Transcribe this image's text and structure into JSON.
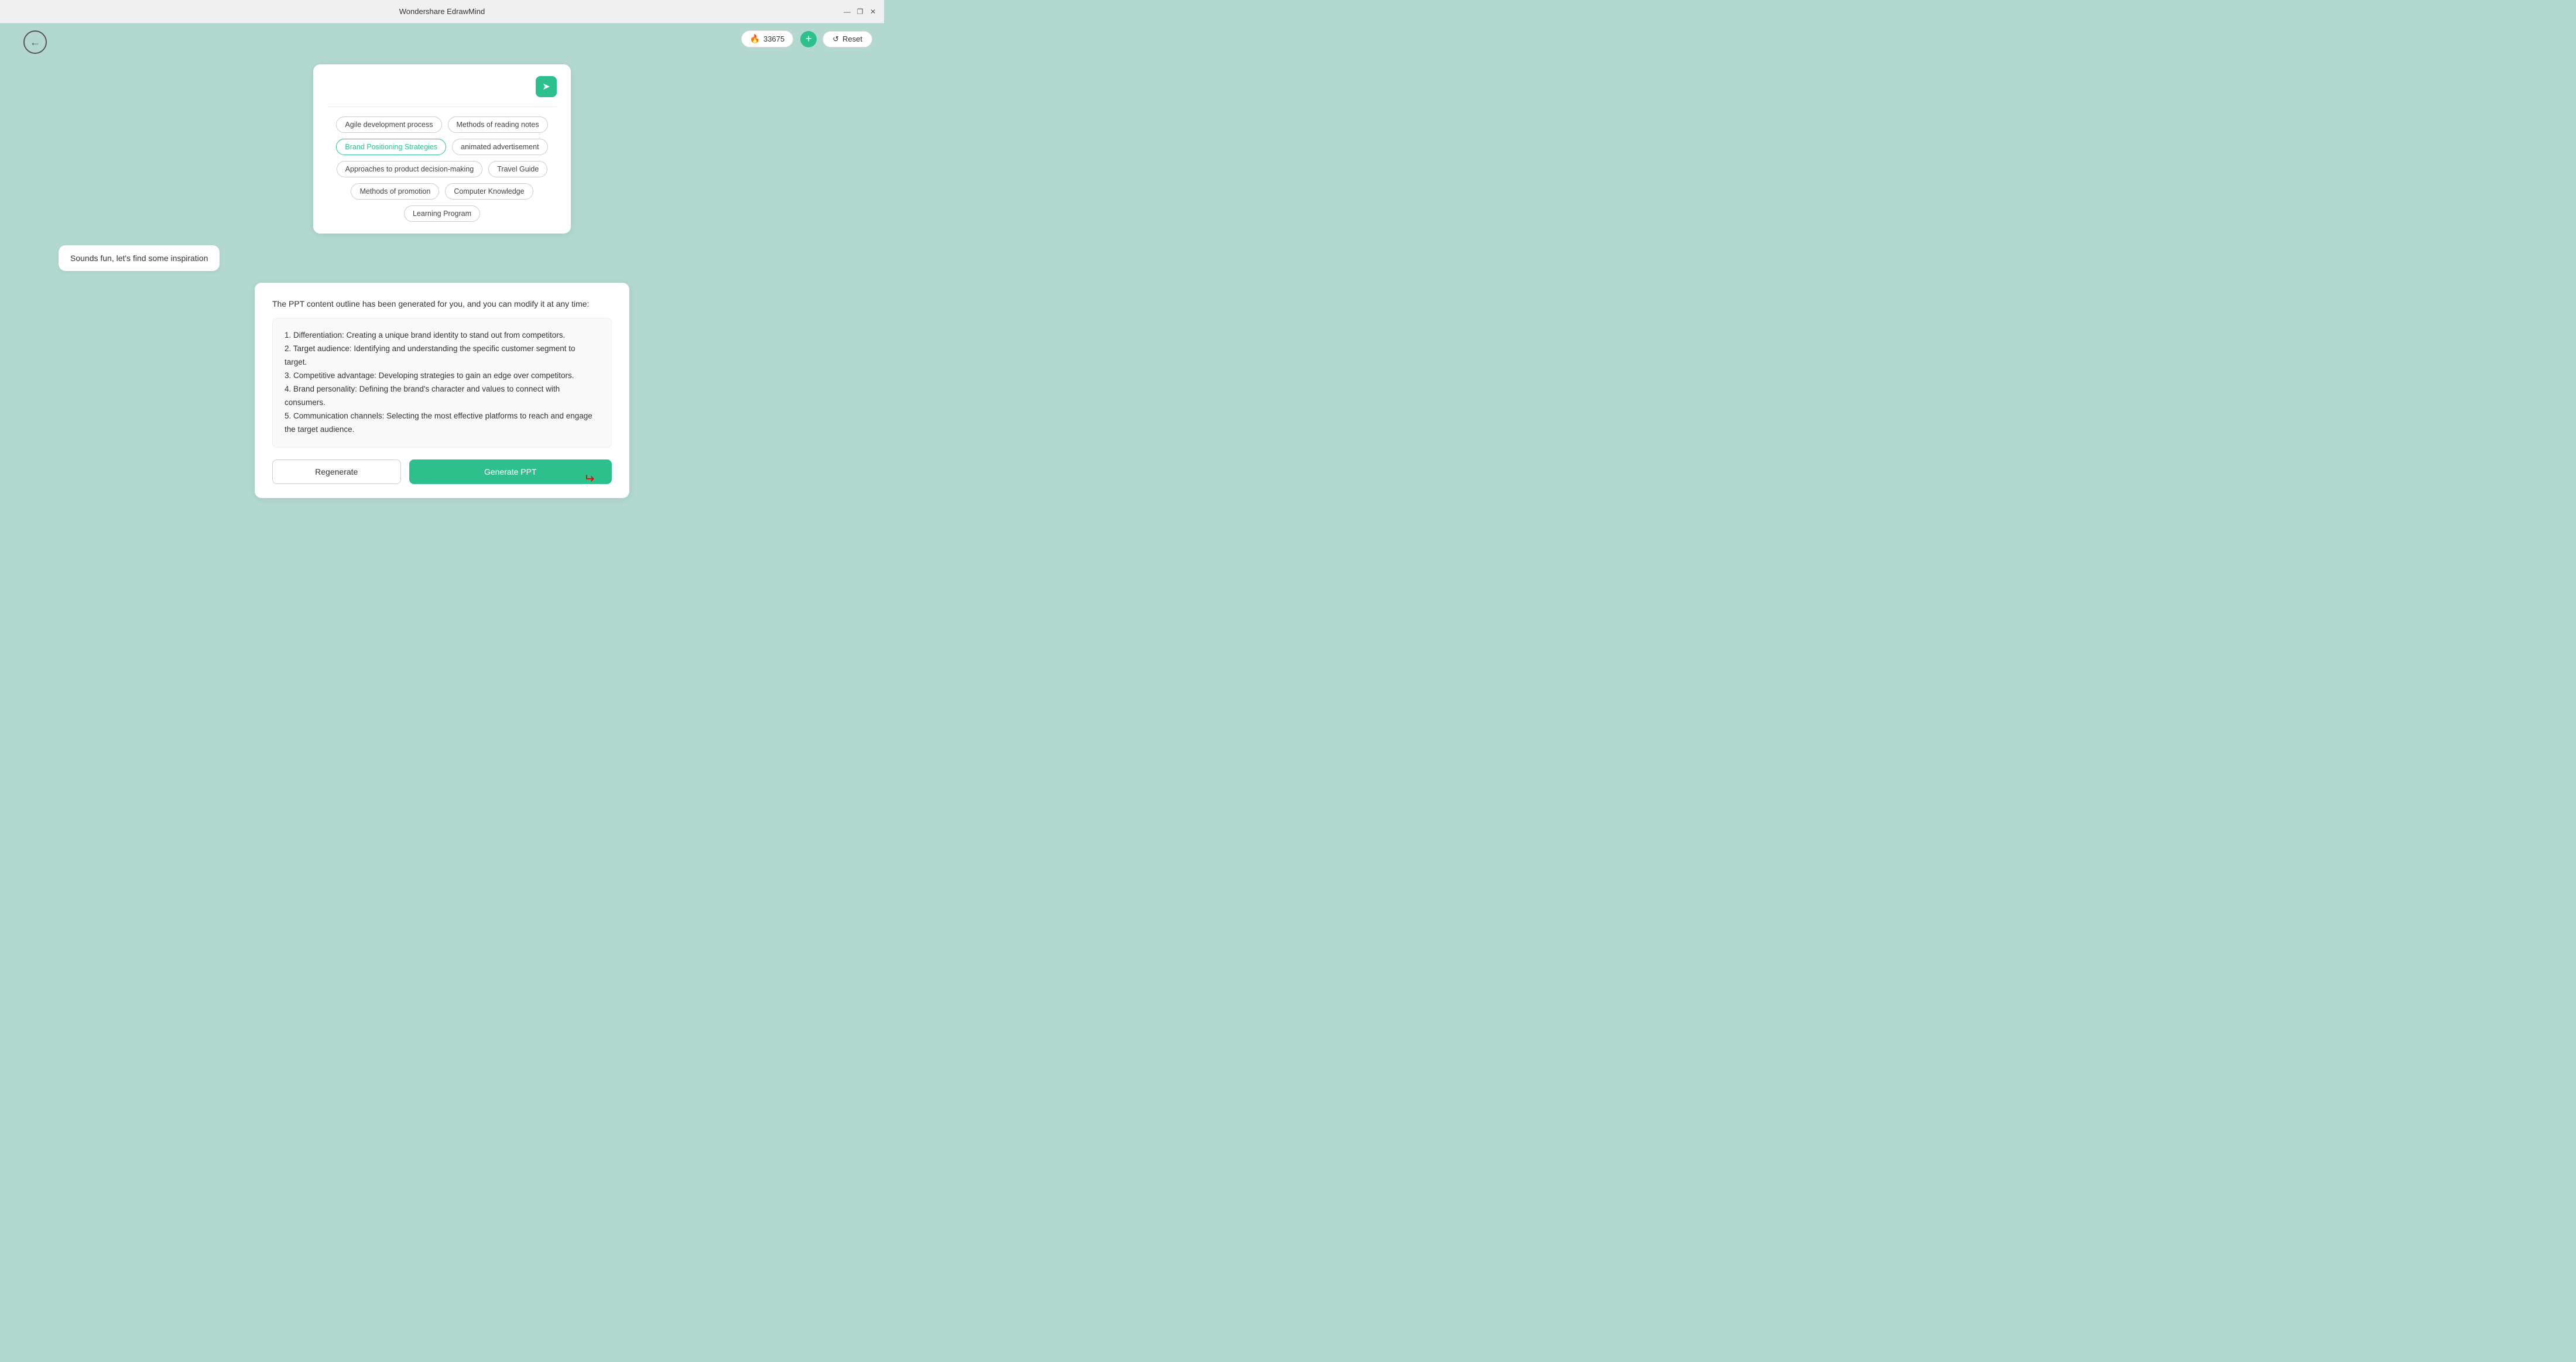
{
  "titlebar": {
    "title": "Wondershare EdrawMind",
    "minimize": "—",
    "maximize": "❐",
    "close": "✕"
  },
  "topright": {
    "credits": "33675",
    "add_label": "+",
    "reset_label": "Reset"
  },
  "back_button": "←",
  "input": {
    "placeholder": ""
  },
  "chips": [
    {
      "label": "Agile development process",
      "active": false
    },
    {
      "label": "Methods of reading notes",
      "active": false
    },
    {
      "label": "Brand Positioning Strategies",
      "active": true
    },
    {
      "label": "animated advertisement",
      "active": false
    },
    {
      "label": "Approaches to product decision-making",
      "active": false
    },
    {
      "label": "Travel Guide",
      "active": false
    },
    {
      "label": "Methods of promotion",
      "active": false
    },
    {
      "label": "Computer Knowledge",
      "active": false
    },
    {
      "label": "Learning Program",
      "active": false
    }
  ],
  "sounds_fun": "Sounds fun, let's find some inspiration",
  "ppt": {
    "title": "The PPT content outline has been generated for you, and you can modify it at any time:",
    "content_lines": [
      "1. Differentiation: Creating a unique brand identity to stand out from competitors.",
      "2. Target audience: Identifying and understanding the specific customer segment to target.",
      "3. Competitive advantage: Developing strategies to gain an edge over competitors.",
      "4. Brand personality: Defining the brand's character and values to connect with consumers.",
      "5. Communication channels: Selecting the most effective platforms to reach and engage the target audience."
    ],
    "regenerate": "Regenerate",
    "generate": "Generate PPT"
  }
}
